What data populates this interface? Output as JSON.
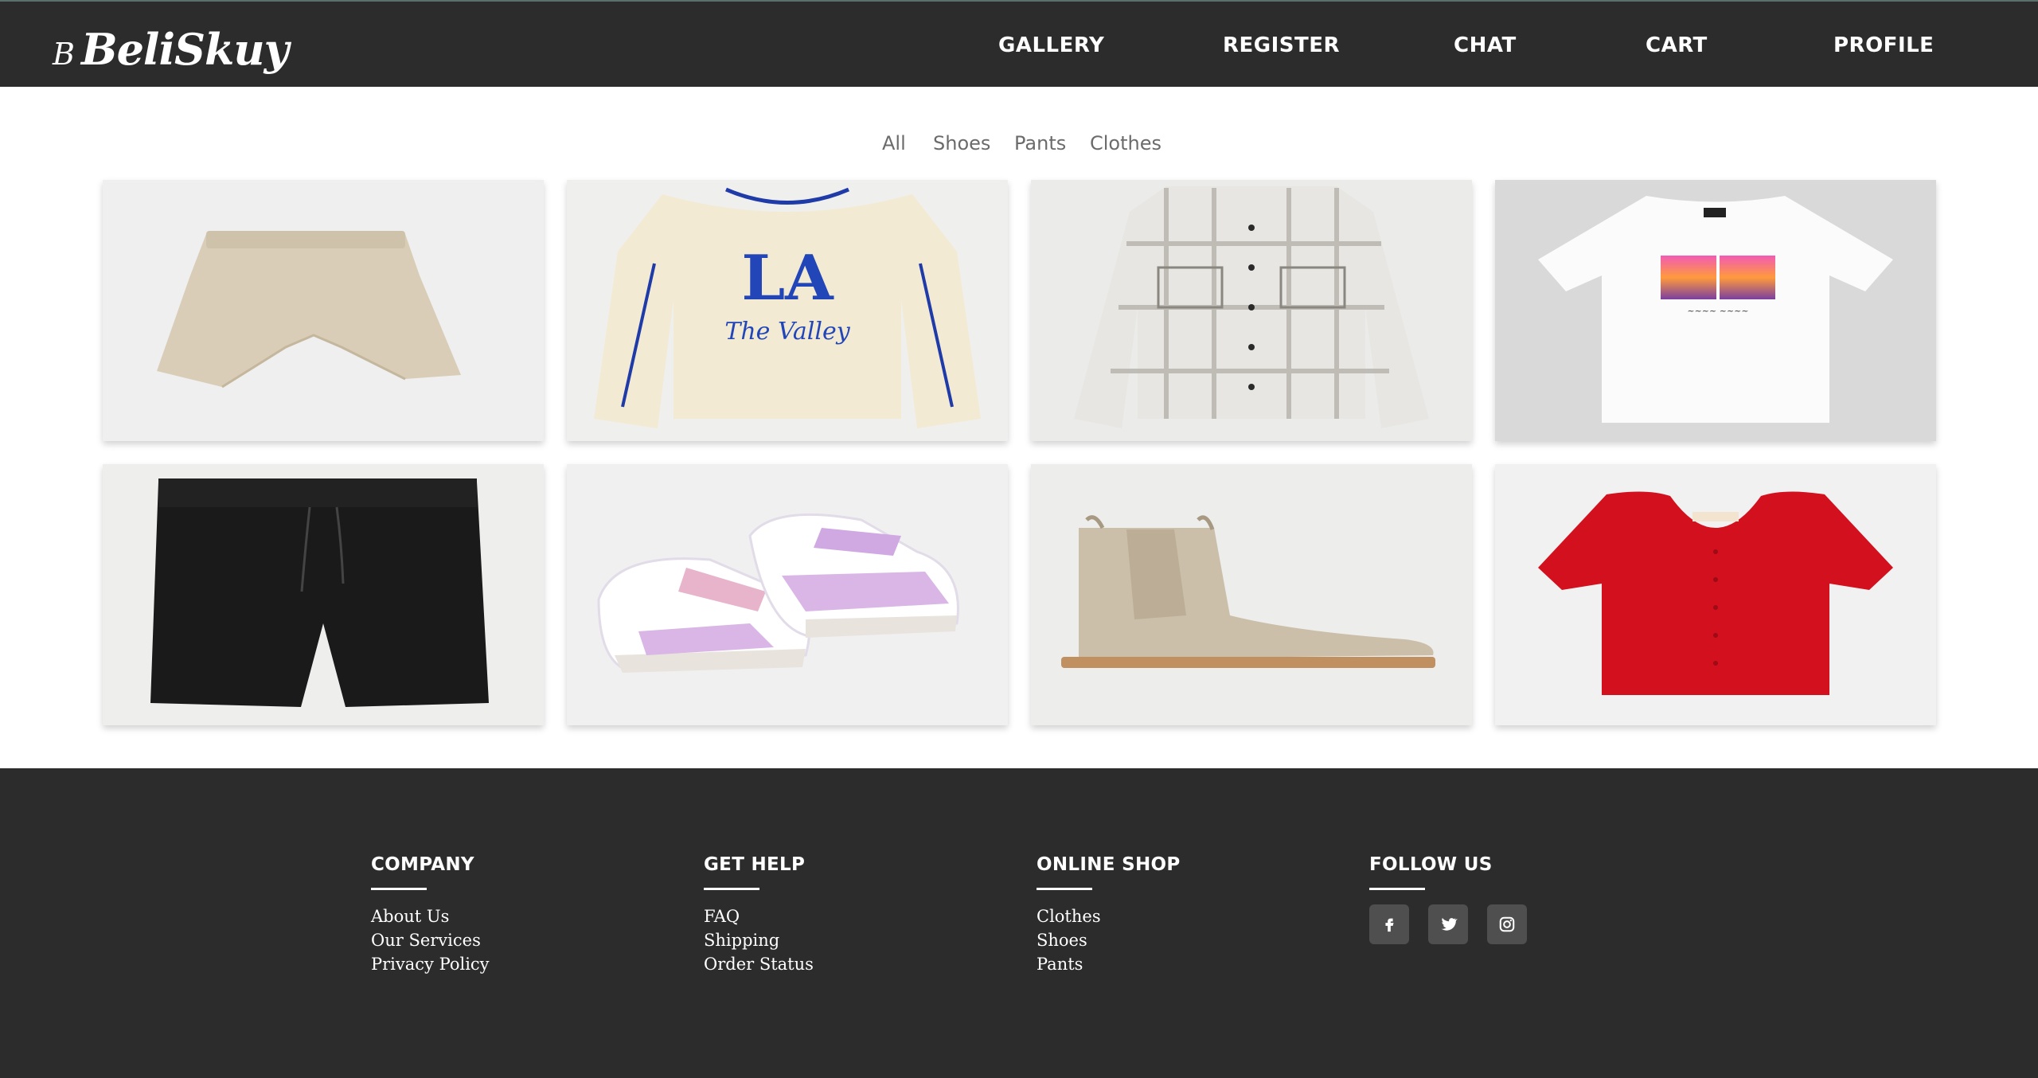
{
  "brand": {
    "mark": "B",
    "name": "BeliSkuy"
  },
  "nav": [
    "GALLERY",
    "REGISTER",
    "CHAT",
    "CART",
    "PROFILE"
  ],
  "filters": [
    "All",
    "Shoes",
    "Pants",
    "Clothes"
  ],
  "products": [
    {
      "icon": "beige-shorts-image"
    },
    {
      "icon": "la-sweatshirt-image"
    },
    {
      "icon": "plaid-shirt-image"
    },
    {
      "icon": "white-tshirt-image"
    },
    {
      "icon": "black-shorts-image"
    },
    {
      "icon": "pink-sneakers-image"
    },
    {
      "icon": "beige-chelsea-boot-image"
    },
    {
      "icon": "red-crop-top-image"
    }
  ],
  "footer": {
    "company": {
      "title": "COMPANY",
      "links": [
        "About Us",
        "Our Services",
        "Privacy Policy"
      ]
    },
    "help": {
      "title": "GET HELP",
      "links": [
        "FAQ",
        "Shipping",
        "Order Status"
      ]
    },
    "shop": {
      "title": "ONLINE SHOP",
      "links": [
        "Clothes",
        "Shoes",
        "Pants"
      ]
    },
    "follow": {
      "title": "FOLLOW US",
      "icons": [
        "facebook-icon",
        "twitter-icon",
        "instagram-icon"
      ]
    }
  },
  "colors": {
    "header": "#2c2c2c",
    "footer": "#2c2c2c",
    "accent_red": "#d3101e"
  }
}
